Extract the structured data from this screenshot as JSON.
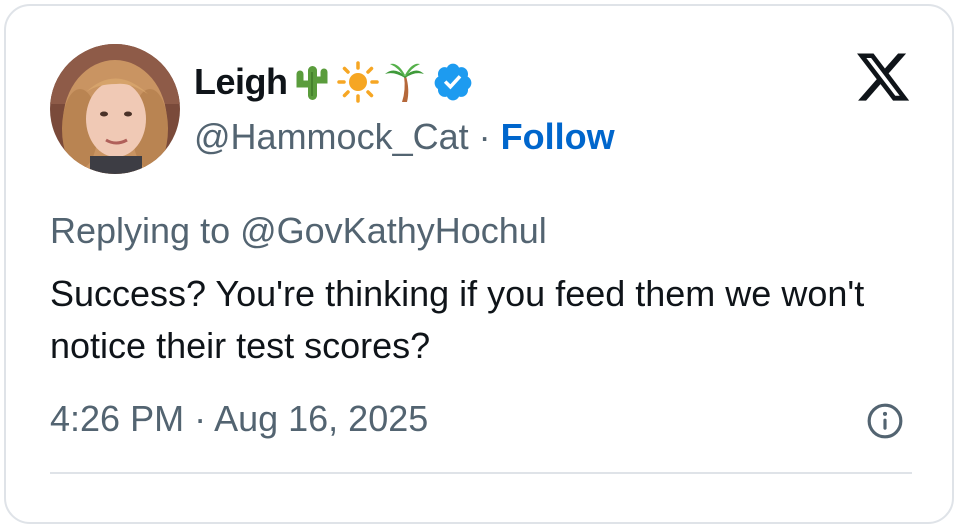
{
  "author": {
    "name": "Leigh",
    "emojis": [
      "cactus",
      "sun",
      "palm-tree"
    ],
    "verified": true,
    "handle": "@Hammock_Cat",
    "separator": "·",
    "follow_label": "Follow"
  },
  "tweet": {
    "replying_to": "Replying to @GovKathyHochul",
    "text": "Success? You're thinking if you feed them we won't notice their test scores?",
    "timestamp": "4:26 PM · Aug 16, 2025"
  },
  "icons": {
    "logo": "x-logo-icon",
    "info": "info-icon",
    "verified": "verified-badge-icon"
  },
  "colors": {
    "accent": "#0066cc",
    "verified": "#1d9bf0",
    "text": "#0f1419",
    "muted": "#536471",
    "border": "#dfe3e8"
  }
}
